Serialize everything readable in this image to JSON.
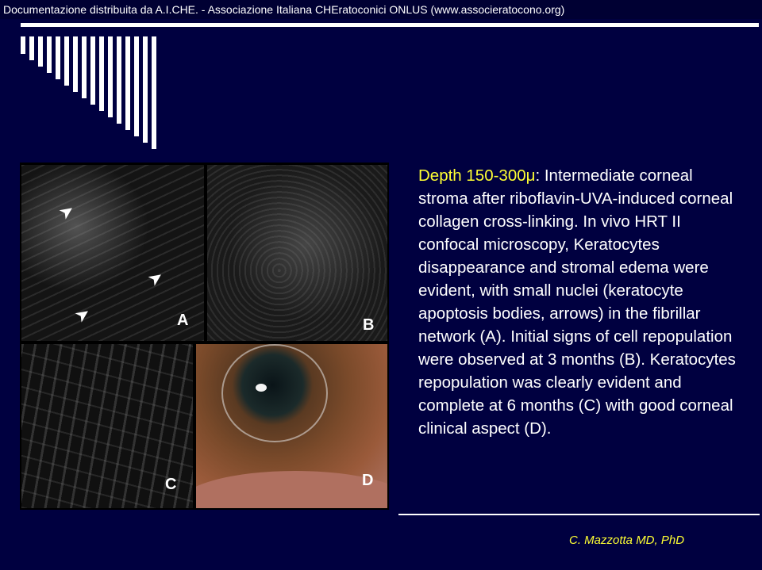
{
  "header": {
    "text": "Documentazione distribuita da A.I.CHE. - Associazione Italiana CHEratoconici ONLUS (www.associeratocono.org)"
  },
  "figure": {
    "panels": [
      {
        "letter": "A",
        "icon": "arrow-icon"
      },
      {
        "letter": "B"
      },
      {
        "letter": "C"
      },
      {
        "letter": "D"
      }
    ]
  },
  "description": {
    "highlight": "Depth 150-300μ",
    "body": ": Intermediate corneal stroma after riboflavin-UVA-induced corneal collagen cross-linking. In vivo HRT II confocal microscopy, Keratocytes disappearance and stromal edema were evident, with small nuclei (keratocyte apoptosis bodies, arrows) in the fibrillar network (A). Initial signs of cell repopulation were observed at 3 months (B). Keratocytes repopulation was clearly evident and complete at 6 months (C) with good corneal clinical aspect (D)."
  },
  "author": "C. Mazzotta MD, PhD",
  "colors": {
    "background": "#000040",
    "highlight": "#ffff33",
    "text": "#ffffff"
  }
}
